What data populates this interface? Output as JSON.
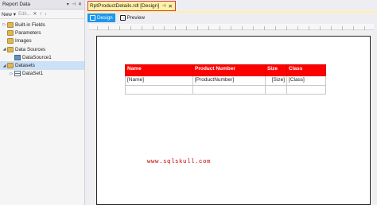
{
  "left_panel": {
    "title": "Report Data",
    "controls": [
      "▾",
      "⊣",
      "✕"
    ],
    "toolbar": {
      "new_label": "New ▾",
      "edit_label": "Edit...",
      "icons": [
        "✕",
        "↑",
        "↓"
      ]
    },
    "tree": [
      {
        "label": "Built-in Fields",
        "expander": "▷",
        "icon": "folder-icon",
        "indent": 0,
        "selected": false
      },
      {
        "label": "Parameters",
        "expander": "",
        "icon": "folder-icon",
        "indent": 0,
        "selected": false
      },
      {
        "label": "Images",
        "expander": "",
        "icon": "folder-icon",
        "indent": 0,
        "selected": false
      },
      {
        "label": "Data Sources",
        "expander": "◢",
        "icon": "folder-icon",
        "indent": 0,
        "selected": false
      },
      {
        "label": "DataSource1",
        "expander": "",
        "icon": "datasource-icon",
        "indent": 1,
        "selected": false
      },
      {
        "label": "Datasets",
        "expander": "◢",
        "icon": "folder-icon",
        "indent": 0,
        "selected": true
      },
      {
        "label": "DataSet1",
        "expander": "▷",
        "icon": "table-icon",
        "indent": 1,
        "selected": false
      }
    ]
  },
  "doc_tab": {
    "title": "RptProductDetails.rdl [Design]",
    "pin": "⊣",
    "close": "✕"
  },
  "subtabs": [
    {
      "label": "Design",
      "active": true
    },
    {
      "label": "Preview",
      "active": false
    }
  ],
  "report": {
    "headers": [
      "Name",
      "Product Number",
      "Size",
      "Class"
    ],
    "row": [
      "[Name]",
      "[ProductNumber]",
      "[Size]",
      "[Class]"
    ],
    "watermark": "www.sqlskull.com"
  },
  "colors": {
    "header_bg": "#ff0000",
    "accent": "#1c97ea",
    "tab_highlight": "#fff1a8",
    "tab_border": "#d93a3a"
  }
}
